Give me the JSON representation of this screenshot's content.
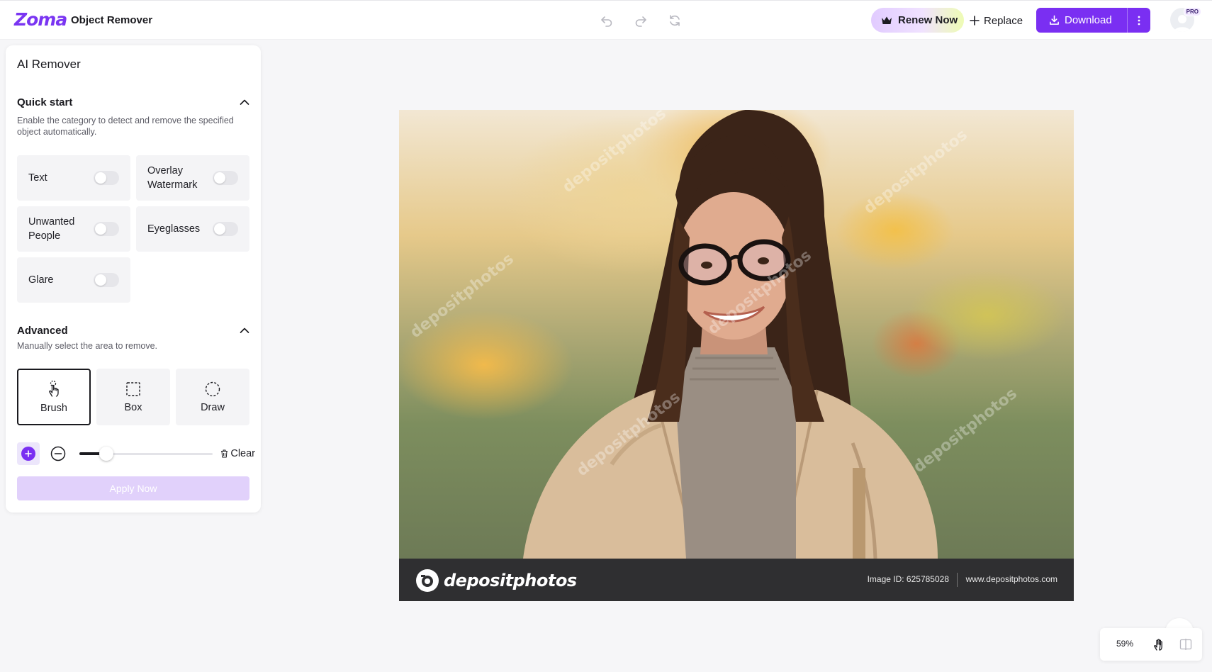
{
  "header": {
    "logo_text": "Zoma",
    "app_title": "Object Remover",
    "renew_label": "Renew Now",
    "replace_label": "Replace",
    "download_label": "Download",
    "pro_badge": "PRO",
    "accent_color": "#7a2ff2"
  },
  "panel": {
    "title": "AI Remover",
    "quick_start": {
      "title": "Quick start",
      "description": "Enable the category to detect and remove the specified object automatically.",
      "categories": [
        {
          "label": "Text",
          "enabled": false
        },
        {
          "label": "Overlay Watermark",
          "enabled": false
        },
        {
          "label": "Unwanted People",
          "enabled": false
        },
        {
          "label": "Eyeglasses",
          "enabled": false
        },
        {
          "label": "Glare",
          "enabled": false
        }
      ]
    },
    "advanced": {
      "title": "Advanced",
      "description": "Manually select the area to remove.",
      "tools": [
        {
          "label": "Brush",
          "icon": "brush-hand-icon",
          "selected": true
        },
        {
          "label": "Box",
          "icon": "dashed-box-icon",
          "selected": false
        },
        {
          "label": "Draw",
          "icon": "dashed-lasso-icon",
          "selected": false
        }
      ],
      "brush_size_fraction": 0.2,
      "clear_label": "Clear",
      "apply_label": "Apply Now"
    }
  },
  "canvas": {
    "watermark_text": "depositphotos",
    "stock_logo": "depositphotos",
    "image_id": "Image ID: 625785028",
    "site_url": "www.depositphotos.com"
  },
  "zoom": {
    "level": "59%"
  }
}
